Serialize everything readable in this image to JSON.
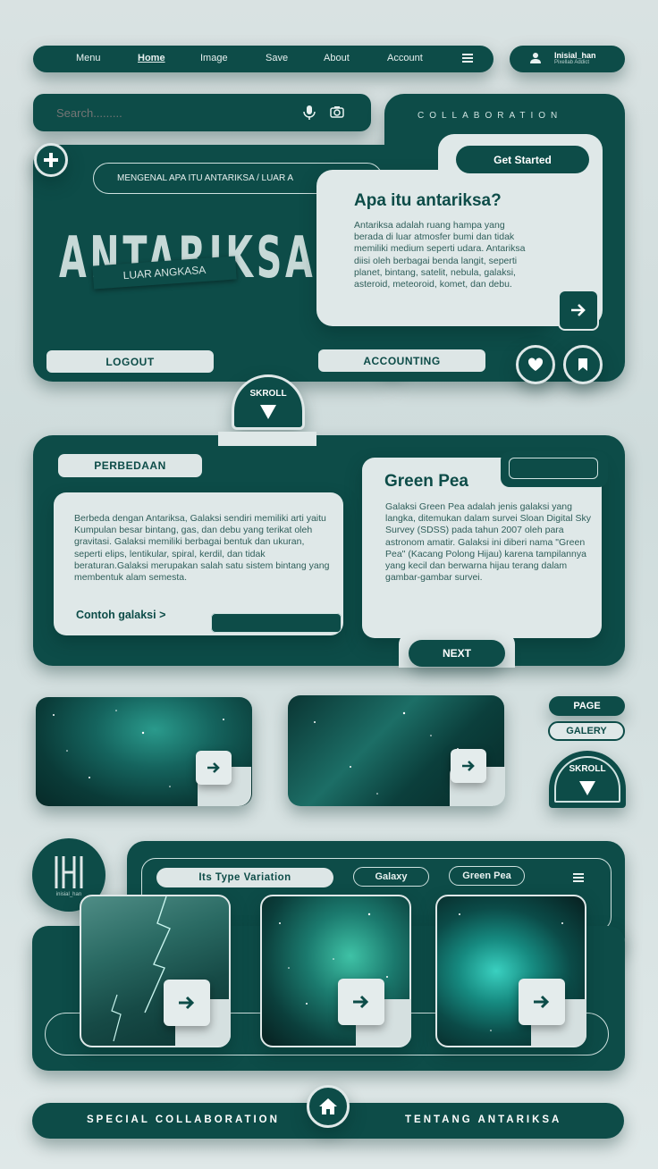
{
  "nav": {
    "items": [
      {
        "label": "Menu",
        "active": false
      },
      {
        "label": "Home",
        "active": true
      },
      {
        "label": "Image",
        "active": false
      },
      {
        "label": "Save",
        "active": false
      },
      {
        "label": "About",
        "active": false
      },
      {
        "label": "Account",
        "active": false
      }
    ],
    "menu_icon": "hamburger-icon"
  },
  "profile": {
    "name": "Inisial_han",
    "subtitle": "Pixellab Addict",
    "icon": "user-icon"
  },
  "search": {
    "placeholder": "Search.........",
    "mic_icon": "microphone-icon",
    "camera_icon": "camera-icon"
  },
  "hero": {
    "collab_label": "COLLABORATION",
    "breadcrumb": "MENGENAL APA ITU ANTARIKSA / LUAR A",
    "big_title": "ANTARIKSA",
    "ribbon": "LUAR ANGKASA",
    "get_started": "Get Started",
    "card_title": "Apa itu antariksa?",
    "card_text": "Antariksa adalah ruang hampa yang berada di luar atmosfer bumi dan tidak memiliki medium seperti udara. Antariksa diisi oleh berbagai benda langit, seperti planet, bintang, satelit, nebula, galaksi, asteroid, meteoroid, komet, dan debu.",
    "logout": "LOGOUT",
    "accounting": "ACCOUNTING",
    "scroll": "SKROLL"
  },
  "section2": {
    "tag": "PERBEDAAN",
    "left_text": "Berbeda dengan Antariksa, Galaksi sendiri memiliki arti yaitu Kumpulan besar bintang, gas, dan debu yang terikat oleh gravitasi. Galaksi memiliki berbagai bentuk dan ukuran, seperti elips, lentikular, spiral, kerdil, dan tidak beraturan.Galaksi merupakan salah satu sistem bintang yang membentuk alam semesta.",
    "left_link": "Contoh galaksi >",
    "right_title": "Green Pea",
    "right_text": "Galaksi Green Pea adalah jenis galaksi yang langka, ditemukan dalam survei Sloan Digital Sky Survey (SDSS) pada tahun 2007 oleh para astronom amatir. Galaksi ini diberi nama \"Green Pea\" (Kacang Polong Hijau) karena tampilannya yang kecil dan berwarna hijau terang dalam gambar-gambar survei.",
    "next": "NEXT"
  },
  "gallery": {
    "page": "PAGE",
    "galery": "GALERY",
    "scroll": "SKROLL"
  },
  "types": {
    "logo_caption": "inisial_han",
    "heading": "Its Type Variation",
    "tab1": "Galaxy",
    "tab2": "Green Pea"
  },
  "footer": {
    "left": "SPECIAL COLLABORATION",
    "right": "TENTANG ANTARIKSA",
    "home_icon": "home-icon"
  },
  "colors": {
    "primary": "#0d4c48",
    "light": "#dfe8e8",
    "accent": "#1fa69a"
  }
}
